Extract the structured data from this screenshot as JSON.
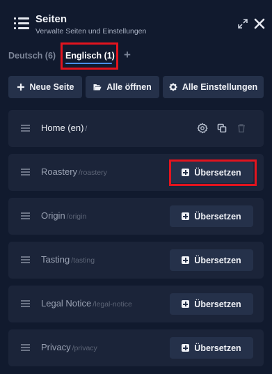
{
  "header": {
    "title": "Seiten",
    "subtitle": "Verwalte Seiten und Einstellungen"
  },
  "tabs": {
    "german": "Deutsch (6)",
    "english": "Englisch (1)",
    "add": "+"
  },
  "toolbar": {
    "new_page": "Neue Seite",
    "open_all": "Alle öffnen",
    "all_settings": "Alle Einstellungen"
  },
  "pages": [
    {
      "name": "Home (en)",
      "slug": "/",
      "translated": true
    },
    {
      "name": "Roastery",
      "slug": "/roastery",
      "button": "Übersetzen"
    },
    {
      "name": "Origin",
      "slug": "/origin",
      "button": "Übersetzen"
    },
    {
      "name": "Tasting",
      "slug": "/tasting",
      "button": "Übersetzen"
    },
    {
      "name": "Legal Notice",
      "slug": "/legal-notice",
      "button": "Übersetzen"
    },
    {
      "name": "Privacy",
      "slug": "/privacy",
      "button": "Übersetzen"
    }
  ],
  "colors": {
    "background": "#111a2e",
    "row": "#1b2439",
    "button": "#25314a",
    "accent": "#4a8ff2",
    "highlight": "#e3141e"
  }
}
